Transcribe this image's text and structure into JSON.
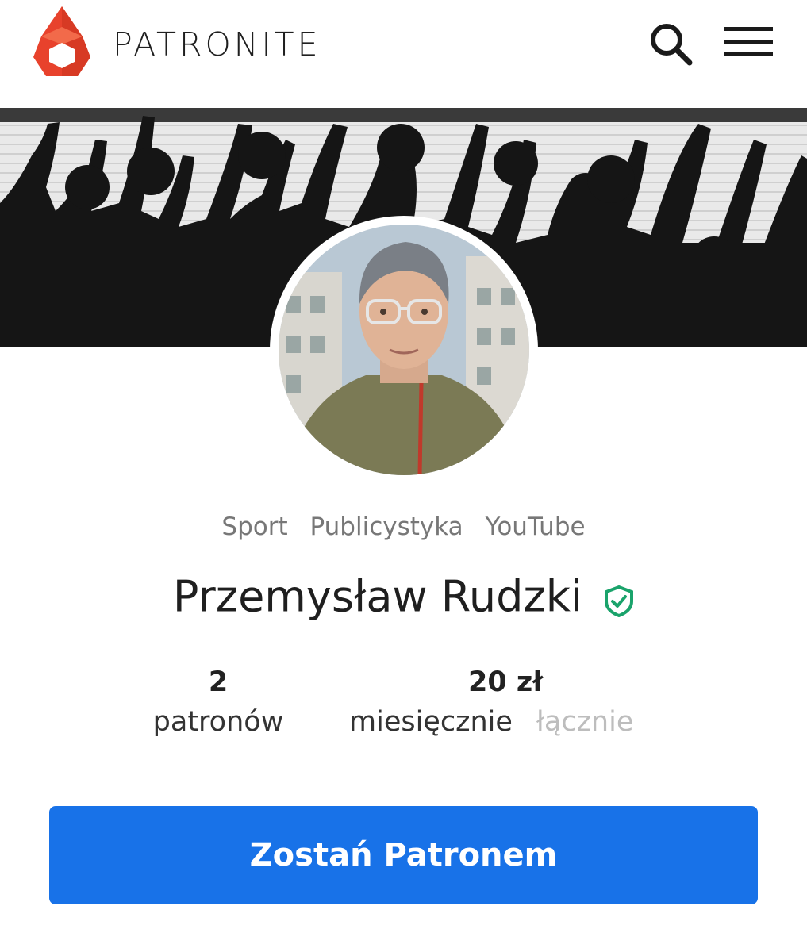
{
  "header": {
    "brand": "PATRONITE",
    "icons": {
      "logo": "patronite-flame-logo",
      "search": "search-icon",
      "menu": "hamburger-menu-icon"
    }
  },
  "profile": {
    "categories": [
      "Sport",
      "Publicystyka",
      "YouTube"
    ],
    "name": "Przemysław Rudzki",
    "verified_icon": "shield-check-icon"
  },
  "stats": {
    "patrons_value": "2",
    "patrons_label": "patronów",
    "amount_value": "20 zł",
    "period_monthly": "miesięcznie",
    "period_total": "łącznie"
  },
  "cta": {
    "label": "Zostań Patronem"
  },
  "colors": {
    "brand_red": "#e8422c",
    "cta_blue": "#1872e8",
    "verified_green": "#1aa36b",
    "muted_text": "#bdbdbd"
  }
}
